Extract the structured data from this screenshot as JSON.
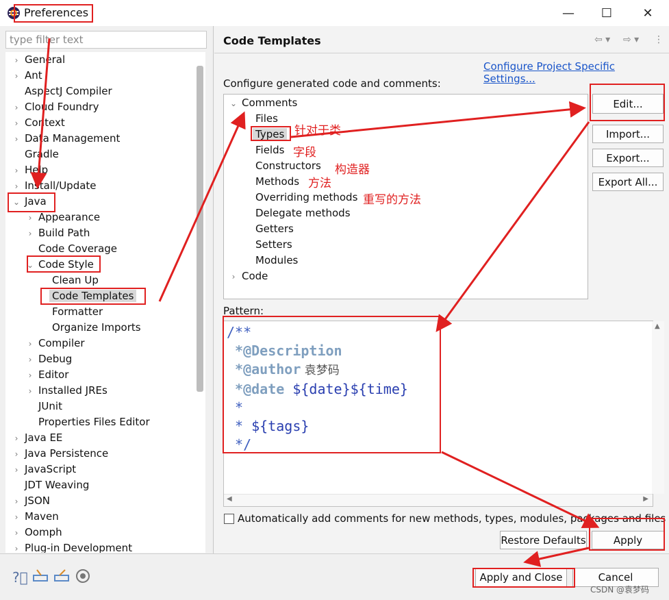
{
  "window": {
    "title": "Preferences"
  },
  "filter": {
    "placeholder": "type filter text"
  },
  "tree": [
    {
      "label": "General",
      "indent": 0,
      "twisty": "›"
    },
    {
      "label": "Ant",
      "indent": 0,
      "twisty": "›"
    },
    {
      "label": "AspectJ Compiler",
      "indent": 0,
      "twisty": ""
    },
    {
      "label": "Cloud Foundry",
      "indent": 0,
      "twisty": "›"
    },
    {
      "label": "Context",
      "indent": 0,
      "twisty": "›"
    },
    {
      "label": "Data Management",
      "indent": 0,
      "twisty": "›"
    },
    {
      "label": "Gradle",
      "indent": 0,
      "twisty": ""
    },
    {
      "label": "Help",
      "indent": 0,
      "twisty": "›"
    },
    {
      "label": "Install/Update",
      "indent": 0,
      "twisty": "›"
    },
    {
      "label": "Java",
      "indent": 0,
      "twisty": "⌄"
    },
    {
      "label": "Appearance",
      "indent": 1,
      "twisty": "›"
    },
    {
      "label": "Build Path",
      "indent": 1,
      "twisty": "›"
    },
    {
      "label": "Code Coverage",
      "indent": 1,
      "twisty": ""
    },
    {
      "label": "Code Style",
      "indent": 1,
      "twisty": "⌄"
    },
    {
      "label": "Clean Up",
      "indent": 2,
      "twisty": ""
    },
    {
      "label": "Code Templates",
      "indent": 2,
      "twisty": "",
      "selected": true
    },
    {
      "label": "Formatter",
      "indent": 2,
      "twisty": ""
    },
    {
      "label": "Organize Imports",
      "indent": 2,
      "twisty": ""
    },
    {
      "label": "Compiler",
      "indent": 1,
      "twisty": "›"
    },
    {
      "label": "Debug",
      "indent": 1,
      "twisty": "›"
    },
    {
      "label": "Editor",
      "indent": 1,
      "twisty": "›"
    },
    {
      "label": "Installed JREs",
      "indent": 1,
      "twisty": "›"
    },
    {
      "label": "JUnit",
      "indent": 1,
      "twisty": ""
    },
    {
      "label": "Properties Files Editor",
      "indent": 1,
      "twisty": ""
    },
    {
      "label": "Java EE",
      "indent": 0,
      "twisty": "›"
    },
    {
      "label": "Java Persistence",
      "indent": 0,
      "twisty": "›"
    },
    {
      "label": "JavaScript",
      "indent": 0,
      "twisty": "›"
    },
    {
      "label": "JDT Weaving",
      "indent": 0,
      "twisty": ""
    },
    {
      "label": "JSON",
      "indent": 0,
      "twisty": "›"
    },
    {
      "label": "Maven",
      "indent": 0,
      "twisty": "›"
    },
    {
      "label": "Oomph",
      "indent": 0,
      "twisty": "›"
    },
    {
      "label": "Plug-in Development",
      "indent": 0,
      "twisty": "›"
    }
  ],
  "page": {
    "title": "Code Templates",
    "config_link": "Configure Project Specific Settings...",
    "description": "Configure generated code and comments:",
    "pattern_label": "Pattern:",
    "auto_comments": "Automatically add comments for new methods, types, modules, packages and files"
  },
  "templates": [
    {
      "label": "Comments",
      "indent": 0,
      "twisty": "⌄"
    },
    {
      "label": "Files",
      "indent": 1,
      "twisty": ""
    },
    {
      "label": "Types",
      "indent": 1,
      "twisty": "",
      "selected": true
    },
    {
      "label": "Fields",
      "indent": 1,
      "twisty": ""
    },
    {
      "label": "Constructors",
      "indent": 1,
      "twisty": ""
    },
    {
      "label": "Methods",
      "indent": 1,
      "twisty": ""
    },
    {
      "label": "Overriding methods",
      "indent": 1,
      "twisty": ""
    },
    {
      "label": "Delegate methods",
      "indent": 1,
      "twisty": ""
    },
    {
      "label": "Getters",
      "indent": 1,
      "twisty": ""
    },
    {
      "label": "Setters",
      "indent": 1,
      "twisty": ""
    },
    {
      "label": "Modules",
      "indent": 1,
      "twisty": ""
    },
    {
      "label": "Code",
      "indent": 0,
      "twisty": "›"
    }
  ],
  "pattern": {
    "l1": "/**",
    "l2_ann": "*@Description",
    "l3_ann": "*@author",
    "l3_rest": " 袁梦码",
    "l4_ann": "*@date",
    "l4_var": " ${date}${time}",
    "l5": " *",
    "l6_star": " * ",
    "l6_var": "${tags}",
    "l7": " */"
  },
  "annotations": {
    "types": "针对于类",
    "fields": "字段",
    "constructors": "构造器",
    "methods": "方法",
    "overriding": "重写的方法"
  },
  "buttons": {
    "edit": "Edit...",
    "import": "Import...",
    "export": "Export...",
    "export_all": "Export All...",
    "restore": "Restore Defaults",
    "apply": "Apply",
    "apply_close": "Apply and Close",
    "cancel": "Cancel"
  },
  "watermark": "CSDN @袁梦码",
  "colors": {
    "annotation": "#e02020",
    "link": "#1a55c9",
    "javadoc": "#3f5fbf"
  }
}
